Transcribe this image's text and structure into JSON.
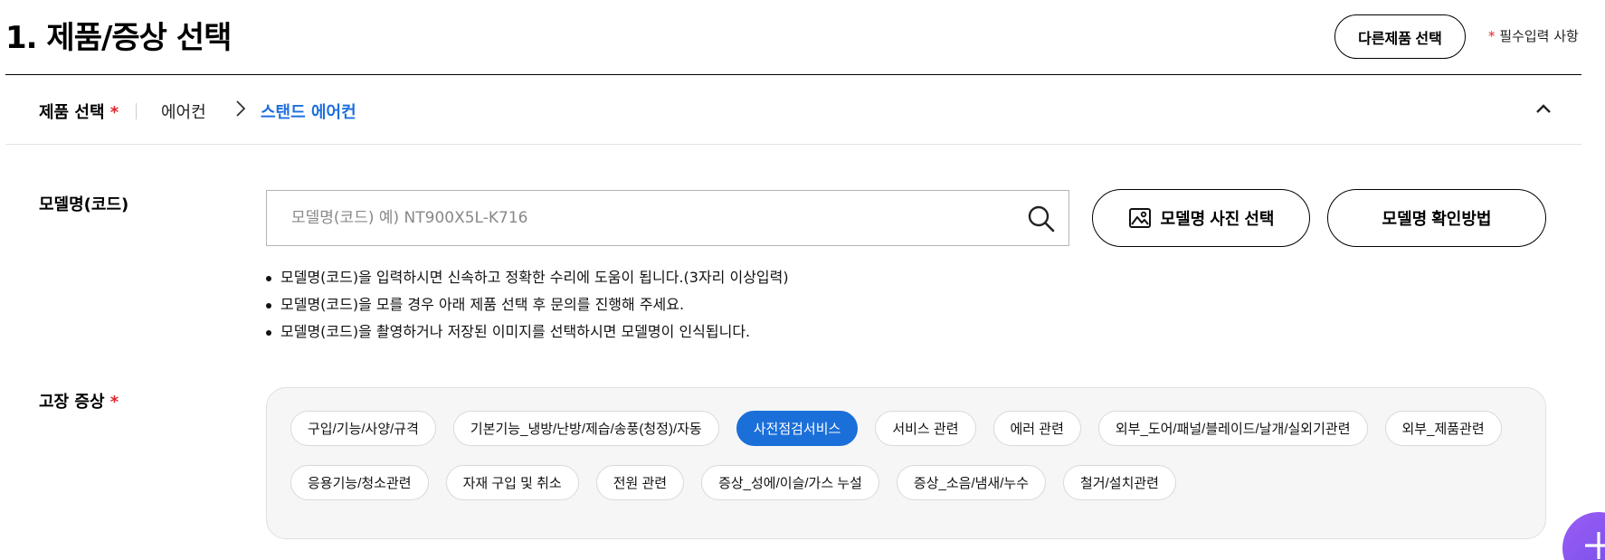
{
  "header": {
    "title": "1. 제품/증상 선택",
    "other_product_button": "다른제품 선택",
    "required_star": "*",
    "required_note": "필수입력 사항"
  },
  "product": {
    "label": "제품 선택",
    "required_star": "*",
    "breadcrumb": [
      "에어컨",
      "스탠드 에어컨"
    ],
    "active_color": "#1d6fe0"
  },
  "model": {
    "label": "모델명(코드)",
    "placeholder": "모델명(코드) 예) NT900X5L-K716",
    "value": "",
    "photo_button": "모델명 사진 선택",
    "howto_button": "모델명 확인방법",
    "notes": [
      "모델명(코드)을 입력하시면 신속하고 정확한 수리에 도움이 됩니다.(3자리 이상입력)",
      "모델명(코드)을 모를 경우 아래 제품 선택 후 문의를 진행해 주세요.",
      "모델명(코드)을 촬영하거나 저장된 이미지를 선택하시면 모델명이 인식됩니다."
    ]
  },
  "symptom": {
    "label": "고장 증상",
    "required_star": "*",
    "chips": [
      "구입/기능/사양/규격",
      "기본기능_냉방/난방/제습/송풍(청정)/자동",
      "사전점검서비스",
      "서비스 관련",
      "에러 관련",
      "외부_도어/패널/블레이드/날개/실외기관련",
      "외부_제품관련",
      "응용기능/청소관련",
      "자재 구입 및 취소",
      "전원 관련",
      "증상_성에/이슬/가스 누설",
      "증상_소음/냄새/누수",
      "철거/설치관련"
    ],
    "selected_index": 2,
    "selected_color": "#1b6fd9"
  },
  "icons": {
    "breadcrumb_separator": "chevron-right-icon",
    "collapse": "chevron-up-icon",
    "search": "search-icon",
    "photo": "image-icon",
    "fab": "plus-icon"
  },
  "colors": {
    "required": "#e0262b",
    "fab": "#7d55ee"
  }
}
